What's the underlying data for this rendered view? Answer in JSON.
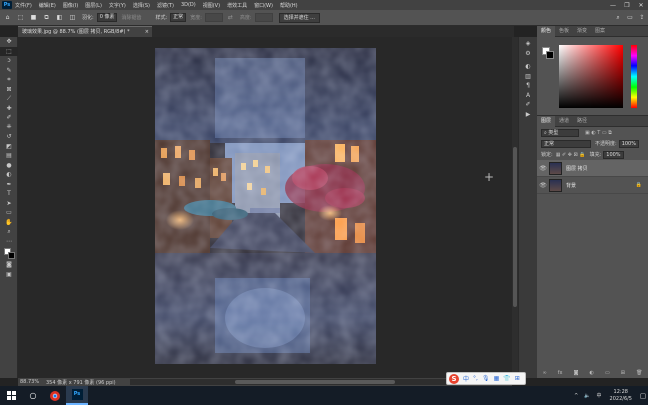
{
  "menubar": {
    "logo": "Ps",
    "items": [
      "文件(F)",
      "编辑(E)",
      "图像(I)",
      "图层(L)",
      "文字(Y)",
      "选择(S)",
      "滤镜(T)",
      "3D(D)",
      "视图(V)",
      "增效工具",
      "窗口(W)",
      "帮助(H)"
    ],
    "window_controls": [
      "—",
      "❐",
      "✕"
    ]
  },
  "options": {
    "feather_label": "羽化:",
    "feather_value": "0 像素",
    "antialias": "消除锯齿",
    "style_label": "样式:",
    "style_value": "正常",
    "width_label": "宽度:",
    "height_label": "高度:",
    "select_mask": "选择并遮住 ..."
  },
  "document": {
    "tab_title": "玻璃效果.jpg @ 88.7% (图层 拷贝, RGB/8#) *",
    "close": "×"
  },
  "tools": [
    "move-tool",
    "marquee-tool",
    "lasso-tool",
    "quick-select-tool",
    "crop-tool",
    "frame-tool",
    "eyedropper-tool",
    "healing-tool",
    "brush-tool",
    "clone-tool",
    "history-brush-tool",
    "eraser-tool",
    "gradient-tool",
    "blur-tool",
    "dodge-tool",
    "pen-tool",
    "type-tool",
    "path-select-tool",
    "shape-tool",
    "hand-tool",
    "zoom-tool",
    "more-tools",
    "color-swatches",
    "quick-mask",
    "screen-mode"
  ],
  "status": {
    "zoom": "88.73%",
    "info": "354 像素 x 791 像素 (96 ppi)"
  },
  "color_panel": {
    "tabs": [
      "颜色",
      "色板",
      "渐变",
      "图案"
    ]
  },
  "layers_panel": {
    "tabs": [
      "图层",
      "通道",
      "路径"
    ],
    "filter_label": "类型",
    "blend_mode": "正常",
    "opacity_label": "不透明度:",
    "opacity_value": "100%",
    "lock_label": "锁定:",
    "fill_label": "填充:",
    "fill_value": "100%",
    "layers": [
      {
        "name": "图层 拷贝",
        "selected": true,
        "locked": false
      },
      {
        "name": "背景",
        "selected": false,
        "locked": true
      }
    ]
  },
  "ime": {
    "logo": "S",
    "items": [
      "中",
      "°,",
      "🎙",
      "▦",
      "👕",
      "⊞"
    ]
  },
  "taskbar": {
    "tray_items": [
      "^",
      "🔈",
      "中"
    ],
    "time": "12:28",
    "date": "2022/6/5"
  },
  "colors": {
    "accent": "#31a8ff",
    "ps_bg": "#001e36"
  }
}
